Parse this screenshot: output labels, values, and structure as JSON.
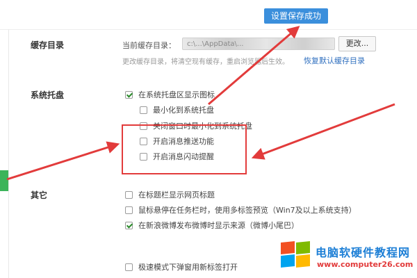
{
  "toast": {
    "text": "设置保存成功"
  },
  "cache": {
    "section_label": "缓存目录",
    "current_label": "当前缓存目录：",
    "path_value": "c:\\...\\AppData\\...",
    "change_button": "更改...",
    "note": "更改缓存目录，将清空现有缓存，重启浏览器后生效。",
    "restore_link": "恢复默认缓存目录"
  },
  "tray": {
    "section_label": "系统托盘",
    "options": [
      {
        "label": "在系统托盘区显示图标",
        "checked": true
      },
      {
        "label": "最小化到系统托盘",
        "checked": false
      },
      {
        "label": "关闭窗口时最小化到系统托盘",
        "checked": false
      },
      {
        "label": "开启消息推送功能",
        "checked": false
      },
      {
        "label": "开启消息闪动提醒",
        "checked": false
      }
    ]
  },
  "other": {
    "section_label": "其它",
    "options": [
      {
        "label": "在标题栏显示网页标题",
        "checked": false
      },
      {
        "label": "鼠标悬停在任务栏时，使用多标签预览（Win7及以上系统支持）",
        "checked": false
      },
      {
        "label": "在新浪微博发布微博时显示来源（微博小尾巴）",
        "checked": true
      },
      {
        "label": "极速模式下弹窗用新标签打开",
        "checked": false
      }
    ]
  },
  "watermark": {
    "title": "电脑软硬件教程网",
    "url": "www.computer26.com"
  },
  "colors": {
    "accent_blue": "#3b8fdc",
    "annotation_red": "#e23b3b",
    "check_green": "#2a8a2a",
    "logo_blue": "#1d7fd6"
  }
}
